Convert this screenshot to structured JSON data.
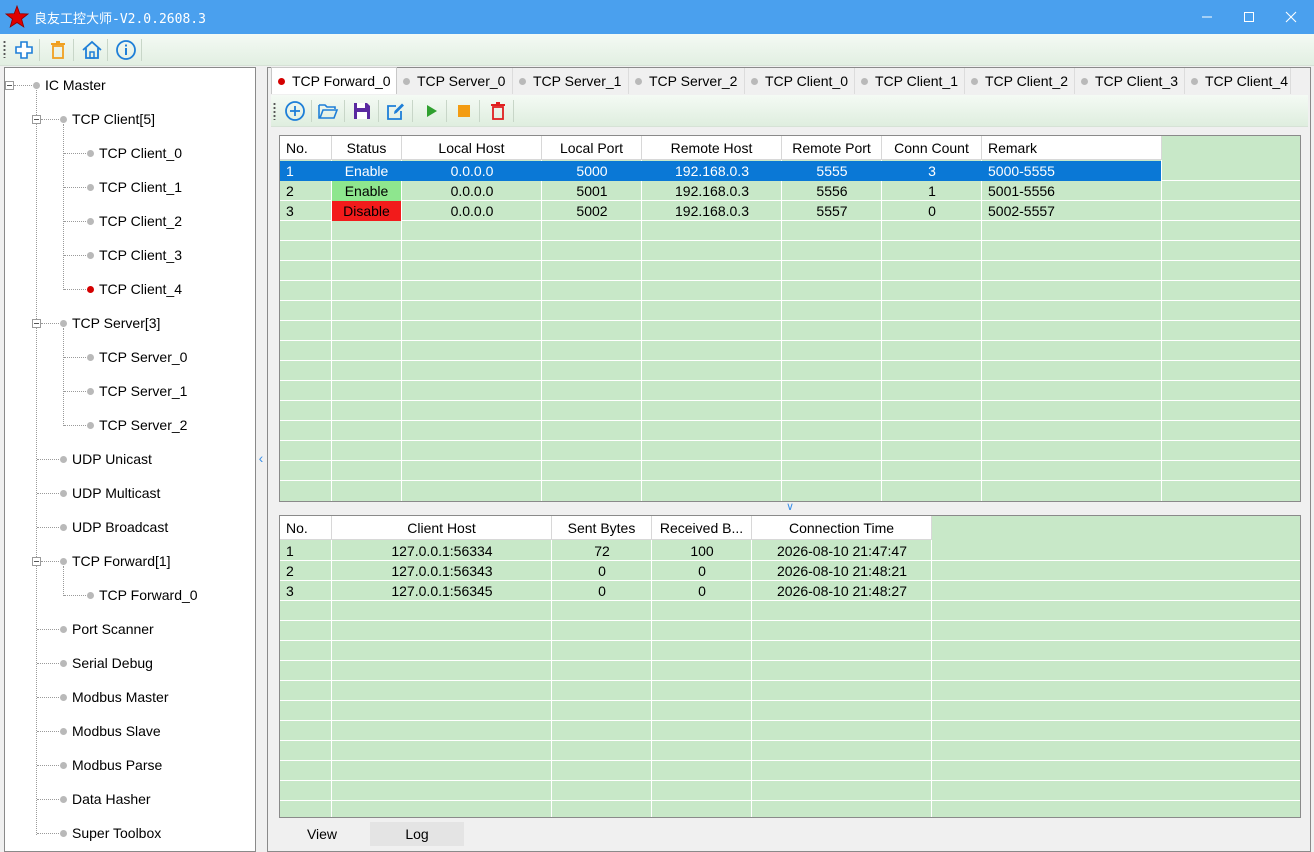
{
  "window": {
    "title": "良友工控大师-V2.0.2608.3",
    "minimize": "—",
    "maximize": "☐",
    "close": "✕"
  },
  "toolbar": {
    "icons": [
      "add-icon",
      "delete-icon",
      "home-icon",
      "info-icon"
    ]
  },
  "tree": {
    "root": "IC Master",
    "tcp_client_group": "TCP Client[5]",
    "tcp_clients": [
      "TCP Client_0",
      "TCP Client_1",
      "TCP Client_2",
      "TCP Client_3",
      "TCP Client_4"
    ],
    "tcp_server_group": "TCP Server[3]",
    "tcp_servers": [
      "TCP Server_0",
      "TCP Server_1",
      "TCP Server_2"
    ],
    "udp_unicast": "UDP Unicast",
    "udp_multicast": "UDP Multicast",
    "udp_broadcast": "UDP Broadcast",
    "tcp_forward_group": "TCP Forward[1]",
    "tcp_forwards": [
      "TCP Forward_0"
    ],
    "port_scanner": "Port Scanner",
    "serial_debug": "Serial Debug",
    "modbus_master": "Modbus Master",
    "modbus_slave": "Modbus Slave",
    "modbus_parse": "Modbus Parse",
    "data_hasher": "Data Hasher",
    "super_toolbox": "Super Toolbox"
  },
  "tabs": [
    "TCP Forward_0",
    "TCP Server_0",
    "TCP Server_1",
    "TCP Server_2",
    "TCP Client_0",
    "TCP Client_1",
    "TCP Client_2",
    "TCP Client_3",
    "TCP Client_4"
  ],
  "forward_toolbar": {
    "icons": [
      "add-circle-icon",
      "open-folder-icon",
      "save-icon",
      "edit-icon",
      "start-icon",
      "stop-icon",
      "delete-icon"
    ]
  },
  "forward_table": {
    "columns": [
      "No.",
      "Status",
      "Local Host",
      "Local Port",
      "Remote Host",
      "Remote Port",
      "Conn Count",
      "Remark"
    ],
    "rows": [
      [
        "1",
        "Enable",
        "0.0.0.0",
        "5000",
        "192.168.0.3",
        "5555",
        "3",
        "5000-5555"
      ],
      [
        "2",
        "Enable",
        "0.0.0.0",
        "5001",
        "192.168.0.3",
        "5556",
        "1",
        "5001-5556"
      ],
      [
        "3",
        "Disable",
        "0.0.0.0",
        "5002",
        "192.168.0.3",
        "5557",
        "0",
        "5002-5557"
      ]
    ]
  },
  "connections_table": {
    "columns": [
      "No.",
      "Client Host",
      "Sent Bytes",
      "Received B...",
      "Connection Time"
    ],
    "rows": [
      [
        "1",
        "127.0.0.1:56334",
        "72",
        "100",
        "2026-08-10 21:47:47"
      ],
      [
        "2",
        "127.0.0.1:56343",
        "0",
        "0",
        "2026-08-10 21:48:21"
      ],
      [
        "3",
        "127.0.0.1:56345",
        "0",
        "0",
        "2026-08-10 21:48:27"
      ]
    ]
  },
  "bottom_tabs": [
    "View",
    "Log"
  ],
  "colors": {
    "titlebar": "#4aa0ee",
    "grid_bg": "#c8e8c8",
    "selected_row": "#0a78d6",
    "enable": "#8ee68e",
    "disable": "#f21b1b",
    "active_dot": "#d40000"
  }
}
